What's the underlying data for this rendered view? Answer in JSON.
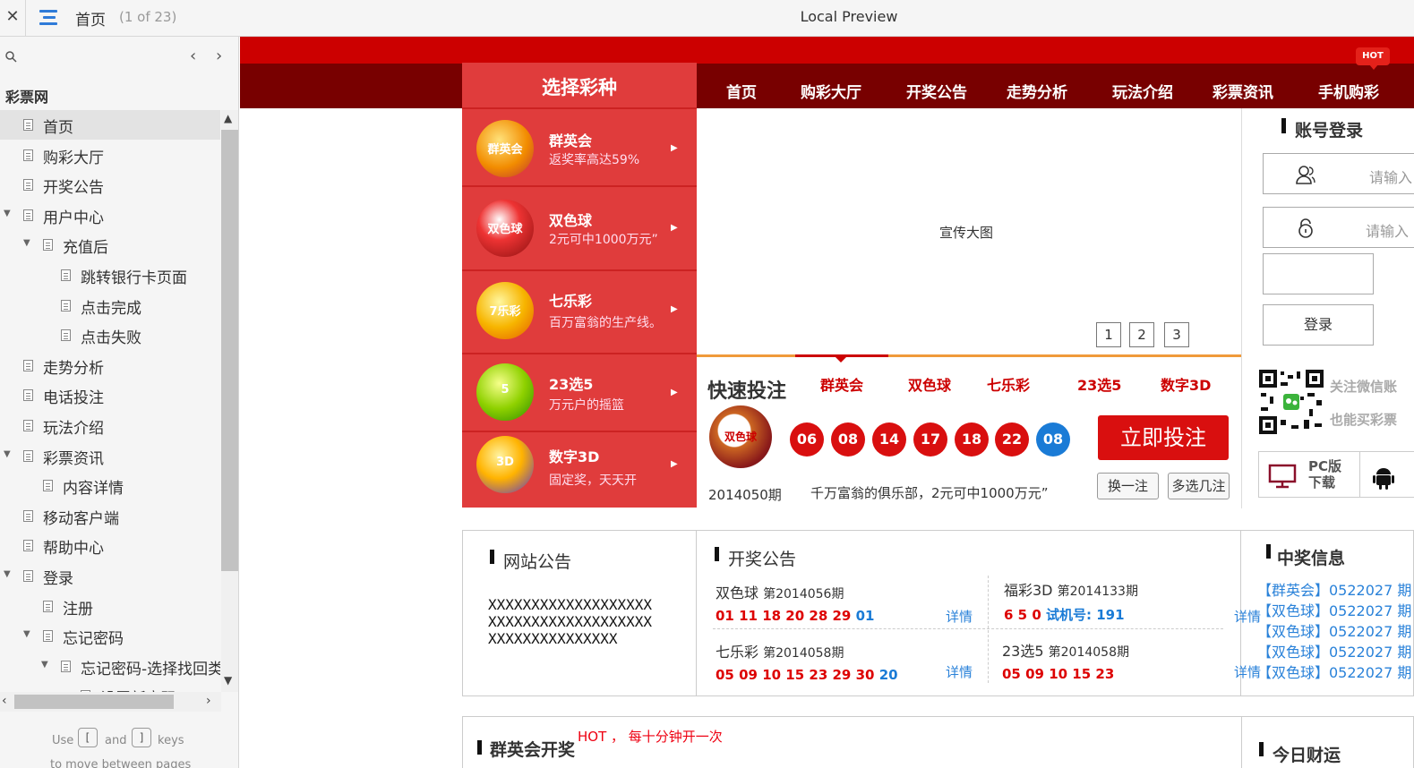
{
  "window": {
    "close_icon": "close-icon",
    "menu_icon": "menu-icon",
    "page_title": "首页",
    "page_count": "(1 of 23)",
    "center_title": "Local Preview"
  },
  "sidebar": {
    "site_name": "彩票网",
    "items": [
      {
        "label": "首页",
        "level": 0,
        "expanded": null,
        "active": true
      },
      {
        "label": "购彩大厅",
        "level": 0,
        "expanded": null
      },
      {
        "label": "开奖公告",
        "level": 0,
        "expanded": null
      },
      {
        "label": "用户中心",
        "level": 0,
        "expanded": true
      },
      {
        "label": "充值后",
        "level": 1,
        "expanded": true
      },
      {
        "label": "跳转银行卡页面",
        "level": 2,
        "expanded": null
      },
      {
        "label": "点击完成",
        "level": 2,
        "expanded": null
      },
      {
        "label": "点击失败",
        "level": 2,
        "expanded": null
      },
      {
        "label": "走势分析",
        "level": 0,
        "expanded": null
      },
      {
        "label": "电话投注",
        "level": 0,
        "expanded": null
      },
      {
        "label": "玩法介绍",
        "level": 0,
        "expanded": null
      },
      {
        "label": "彩票资讯",
        "level": 0,
        "expanded": true
      },
      {
        "label": "内容详情",
        "level": 1,
        "expanded": null
      },
      {
        "label": "移动客户端",
        "level": 0,
        "expanded": null
      },
      {
        "label": "帮助中心",
        "level": 0,
        "expanded": null
      },
      {
        "label": "登录",
        "level": 0,
        "expanded": true
      },
      {
        "label": "注册",
        "level": 1,
        "expanded": null
      },
      {
        "label": "忘记密码",
        "level": 1,
        "expanded": true
      },
      {
        "label": "忘记密码-选择找回类",
        "level": 2,
        "expanded": true
      },
      {
        "label": "设置新密码",
        "level": 3,
        "expanded": null
      }
    ],
    "hint_use": "Use",
    "hint_and": "and",
    "hint_keys": "keys",
    "hint_line2": "to move between pages",
    "key_prev": "[",
    "key_next": "]"
  },
  "site": {
    "hot_badge": "HOT",
    "nav": [
      "首页",
      "购彩大厅",
      "开奖公告",
      "走势分析",
      "玩法介绍",
      "彩票资讯",
      "手机购彩"
    ],
    "panel_title": "选择彩种",
    "lotteries": [
      {
        "name": "群英会",
        "desc": "返奖率高达59%",
        "logo_text": "群英会"
      },
      {
        "name": "双色球",
        "desc": "2元可中1000万元”",
        "logo_text": "双色球"
      },
      {
        "name": "七乐彩",
        "desc": "百万富翁的生产线。",
        "logo_text": "7乐彩"
      },
      {
        "name": "23选5",
        "desc": "万元户的摇篮",
        "logo_text": "5"
      },
      {
        "name": "数字3D",
        "desc": "固定奖，天天开",
        "logo_text": "3D"
      }
    ],
    "banner_text": "宣传大图",
    "slides": [
      "1",
      "2",
      "3"
    ],
    "quick": {
      "title": "快速投注",
      "tabs": [
        "群英会",
        "双色球",
        "七乐彩",
        "23选5",
        "数字3D"
      ],
      "logo_text": "双色球",
      "red_balls": [
        "06",
        "08",
        "14",
        "17",
        "18",
        "22"
      ],
      "blue_balls": [
        "08"
      ],
      "bet_button": "立即投注",
      "change_button": "换一注",
      "multi_button": "多选几注",
      "period": "2014050期",
      "slogan": "千万富翁的俱乐部，2元可中1000万元”"
    },
    "login": {
      "title": "账号登录",
      "username_placeholder": "请输入",
      "password_placeholder": "请输入",
      "login_button": "登录",
      "wechat_line1": "关注微信账",
      "wechat_line2": "也能买彩票",
      "pc_download_line1": "PC版",
      "pc_download_line2": "下载"
    },
    "notice": {
      "title": "网站公告",
      "content": "XXXXXXXXXXXXXXXXXXXXXXXXXXXXXXXXXXXXXXXXXXXXXXXXXXXXX"
    },
    "draws": {
      "title": "开奖公告",
      "items": [
        {
          "name": "双色球",
          "period": "第2014056期",
          "red": "01 11 18 20 28 29",
          "blue": "01",
          "detail": "详情"
        },
        {
          "name": "福彩3D",
          "period": "第2014133期",
          "red": "6 5 0",
          "blue": "试机号: 191",
          "detail": "详情"
        },
        {
          "name": "七乐彩",
          "period": "第2014058期",
          "red": "05 09 10 15 23 29 30",
          "blue": "20",
          "detail": "详情"
        },
        {
          "name": "23选5",
          "period": "第2014058期",
          "red": "05 09 10 15 23",
          "blue": "",
          "detail": "详情"
        }
      ]
    },
    "wins": {
      "title": "中奖信息",
      "lines": [
        "【群英会】0522027 期",
        "【双色球】0522027 期",
        "【双色球】0522027 期",
        "【双色球】0522027 期",
        "【双色球】0522027 期"
      ]
    },
    "row3": {
      "title": "群英会开奖",
      "hot_note": "HOT ，  每十分钟开一次",
      "right_title": "今日财运"
    }
  },
  "colors": {
    "top_red": "#cc0000",
    "nav_dark": "#780000",
    "panel_red": "#e03c3c",
    "ball_red": "#d90f0f",
    "ball_blue": "#1a7bd6",
    "link_blue": "#2a82d9",
    "accent_orange": "#f09a3a"
  }
}
